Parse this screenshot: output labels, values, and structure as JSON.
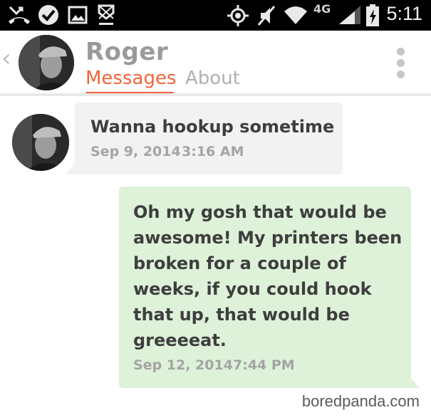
{
  "status_bar": {
    "time": "5:11",
    "network_label": "4G",
    "icons": [
      "missed-call-icon",
      "check-circle-icon",
      "image-icon",
      "download-icon",
      "location-icon",
      "mute-icon",
      "wifi-icon",
      "signal-icon",
      "battery-charging-icon"
    ]
  },
  "header": {
    "back_icon": "chevron-left-icon",
    "back_glyph": "‹",
    "contact_name": "Roger",
    "tabs": [
      {
        "label": "Messages",
        "active": true
      },
      {
        "label": "About",
        "active": false
      }
    ],
    "menu_icon": "overflow-menu-icon",
    "accent_color": "#f0653a"
  },
  "messages": [
    {
      "direction": "incoming",
      "lines": [
        "Wanna hookup sometime"
      ],
      "date": "Sep 9, 2014",
      "time": "3:16 AM",
      "bubble_color": "#f2f2f2"
    },
    {
      "direction": "outgoing",
      "lines": [
        "Oh my gosh that would be",
        "awesome! My printers been",
        "broken for a couple of",
        "weeks, if you could hook",
        "that up, that would be",
        "greeeeat."
      ],
      "date": "Sep 12, 2014",
      "time": "7:44 PM",
      "bubble_color": "#ddf2d8"
    }
  ],
  "watermark": "boredpanda.com"
}
